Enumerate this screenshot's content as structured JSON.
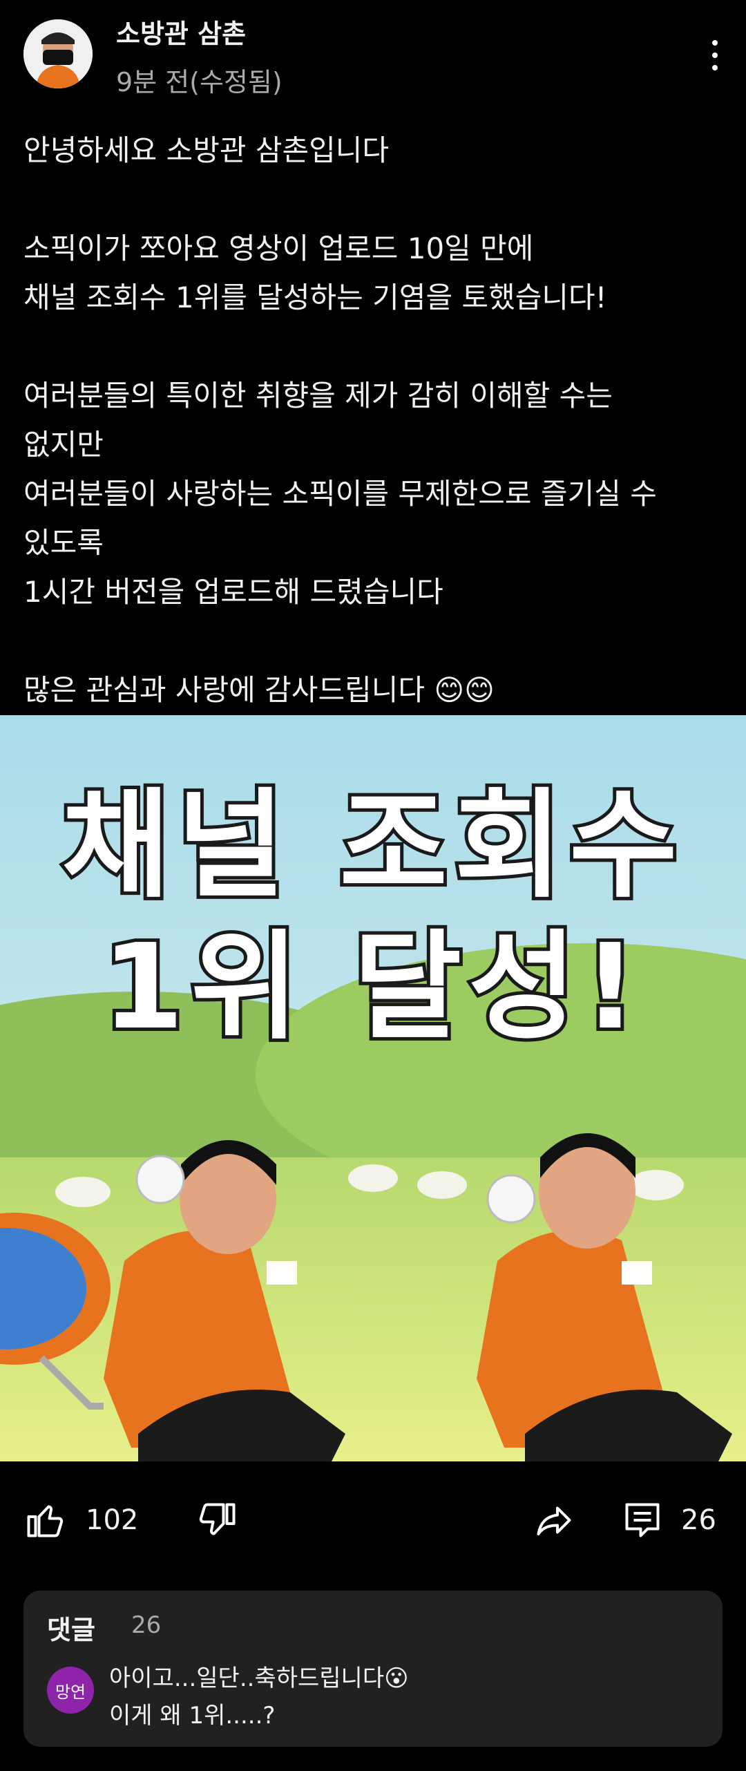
{
  "header": {
    "channel_name": "소방관 삼촌",
    "post_time": "9분 전(수정됨)",
    "more_icon": "more-vertical-icon"
  },
  "post": {
    "lines": [
      "안녕하세요 소방관 삼촌입니다",
      "",
      "소픽이가 쪼아요 영상이 업로드 10일 만에",
      "채널 조회수 1위를 달성하는 기염을 토했습니다!",
      "",
      "여러분들의 특이한 취향을 제가 감히 이해할 수는",
      "없지만",
      "여러분들이 사랑하는 소픽이를 무제한으로 즐기실 수",
      "있도록",
      "1시간 버전을 업로드해 드렸습니다",
      "",
      "많은 관심과 사랑에 감사드립니다 😊😊"
    ]
  },
  "image": {
    "title_line1": "채널 조회수",
    "title_line2": "1위 달성!",
    "colors": {
      "sky": "#bfe3ee",
      "hill": "#9cc86a",
      "uniform": "#e8731e"
    }
  },
  "actions": {
    "likes": "102",
    "comments": "26",
    "icons": [
      "thumb-up-icon",
      "thumb-down-icon",
      "share-icon",
      "comment-icon"
    ]
  },
  "comments": {
    "title": "댓글",
    "count": "26",
    "avatar_text": "망연",
    "avatar_color": "#8e24aa",
    "line1": "아이고...일단..축하드립니다😮",
    "line2": "이게 왜 1위.....?"
  }
}
